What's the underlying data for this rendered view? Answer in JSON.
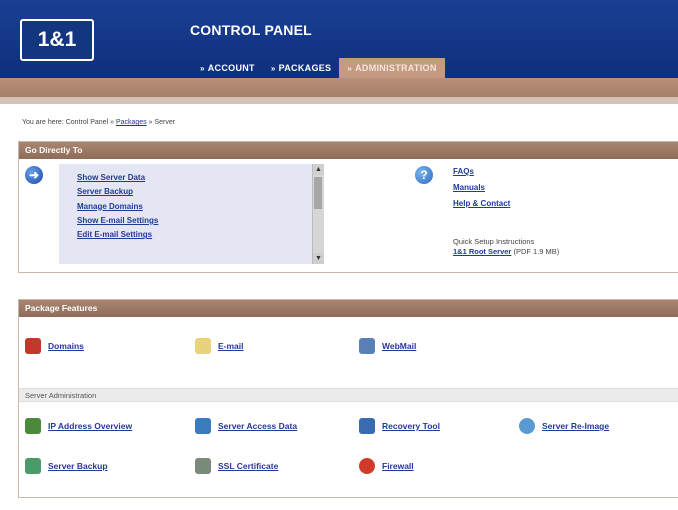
{
  "header": {
    "logo": "1&1",
    "title": "CONTROL PANEL",
    "tabs": [
      {
        "label": "ACCOUNT",
        "bullet": "»"
      },
      {
        "label": "PACKAGES",
        "bullet": "»"
      },
      {
        "label": "ADMINISTRATION",
        "bullet": "»"
      }
    ]
  },
  "breadcrumb": {
    "prefix": "You are here: Control Panel »",
    "packages": "Packages",
    "separator": "»",
    "current": "Server"
  },
  "go_directly": {
    "title": "Go Directly To",
    "links": [
      "Show Server Data",
      "Server Backup",
      "Manage Domains",
      "Show E-mail Settings",
      "Edit E-mail Settings"
    ],
    "scroll_up": "▲",
    "scroll_down": "▼",
    "right_links": [
      "FAQs",
      "Manuals",
      "Help & Contact"
    ],
    "quick_setup_label": "Quick Setup Instructions",
    "quick_setup_link": "1&1 Root Server",
    "quick_setup_size": "(PDF 1.9 MB)"
  },
  "package_features": {
    "title": "Package Features",
    "items": [
      {
        "label": "Domains",
        "icon": "domains-icon",
        "color": "#c0392b"
      },
      {
        "label": "E-mail",
        "icon": "email-icon",
        "color": "#e8d27a"
      },
      {
        "label": "WebMail",
        "icon": "webmail-icon",
        "color": "#5a7fb8"
      }
    ]
  },
  "server_admin": {
    "title": "Server Administration",
    "items": [
      {
        "label": "IP Address Overview",
        "icon": "ip-address-icon",
        "color": "#4a8a3a"
      },
      {
        "label": "Server Access Data",
        "icon": "server-access-icon",
        "color": "#3a7ac0"
      },
      {
        "label": "Recovery Tool",
        "icon": "recovery-tool-icon",
        "color": "#3a6ab0"
      },
      {
        "label": "Server Re-Image",
        "icon": "server-reimage-icon",
        "color": "#5a9ad0"
      },
      {
        "label": "Server Backup",
        "icon": "server-backup-icon",
        "color": "#4a9a6a"
      },
      {
        "label": "SSL Certificate",
        "icon": "ssl-certificate-icon",
        "color": "#7a8a7a"
      },
      {
        "label": "Firewall",
        "icon": "firewall-icon",
        "color": "#d03a2a"
      }
    ]
  }
}
